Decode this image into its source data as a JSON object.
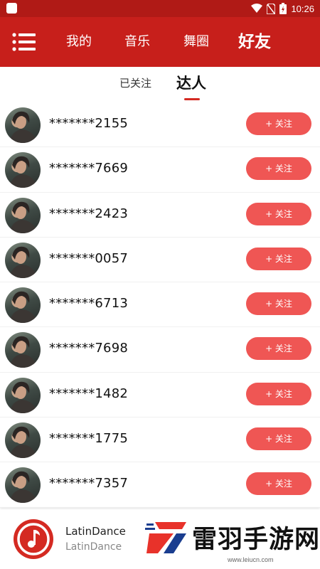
{
  "status_bar": {
    "time": "10:26",
    "icons": [
      "app-notification-icon",
      "wifi-icon",
      "no-sim-icon",
      "battery-charging-icon"
    ]
  },
  "nav": {
    "menu_icon": "menu-icon",
    "tabs": [
      {
        "label": "我的",
        "active": false
      },
      {
        "label": "音乐",
        "active": false
      },
      {
        "label": "舞圈",
        "active": false
      },
      {
        "label": "好友",
        "active": true
      }
    ]
  },
  "sub_tabs": [
    {
      "label": "已关注",
      "active": false
    },
    {
      "label": "达人",
      "active": true
    }
  ],
  "users": [
    {
      "name": "*******2155",
      "follow_label": "+ 关注"
    },
    {
      "name": "*******7669",
      "follow_label": "+ 关注"
    },
    {
      "name": "*******2423",
      "follow_label": "+ 关注"
    },
    {
      "name": "*******0057",
      "follow_label": "+ 关注"
    },
    {
      "name": "*******6713",
      "follow_label": "+ 关注"
    },
    {
      "name": "*******7698",
      "follow_label": "+ 关注"
    },
    {
      "name": "*******1482",
      "follow_label": "+ 关注"
    },
    {
      "name": "*******1775",
      "follow_label": "+ 关注"
    },
    {
      "name": "*******7357",
      "follow_label": "+ 关注"
    }
  ],
  "player": {
    "title": "LatinDance",
    "subtitle": "LatinDance",
    "icon": "music-note-icon"
  },
  "watermark": {
    "text": "雷羽手游网",
    "url": "www.leiucn.com"
  },
  "colors": {
    "header": "#c71f1b",
    "status_bar": "#b01a16",
    "follow_button": "#ef5654",
    "indicator": "#d42a22"
  }
}
